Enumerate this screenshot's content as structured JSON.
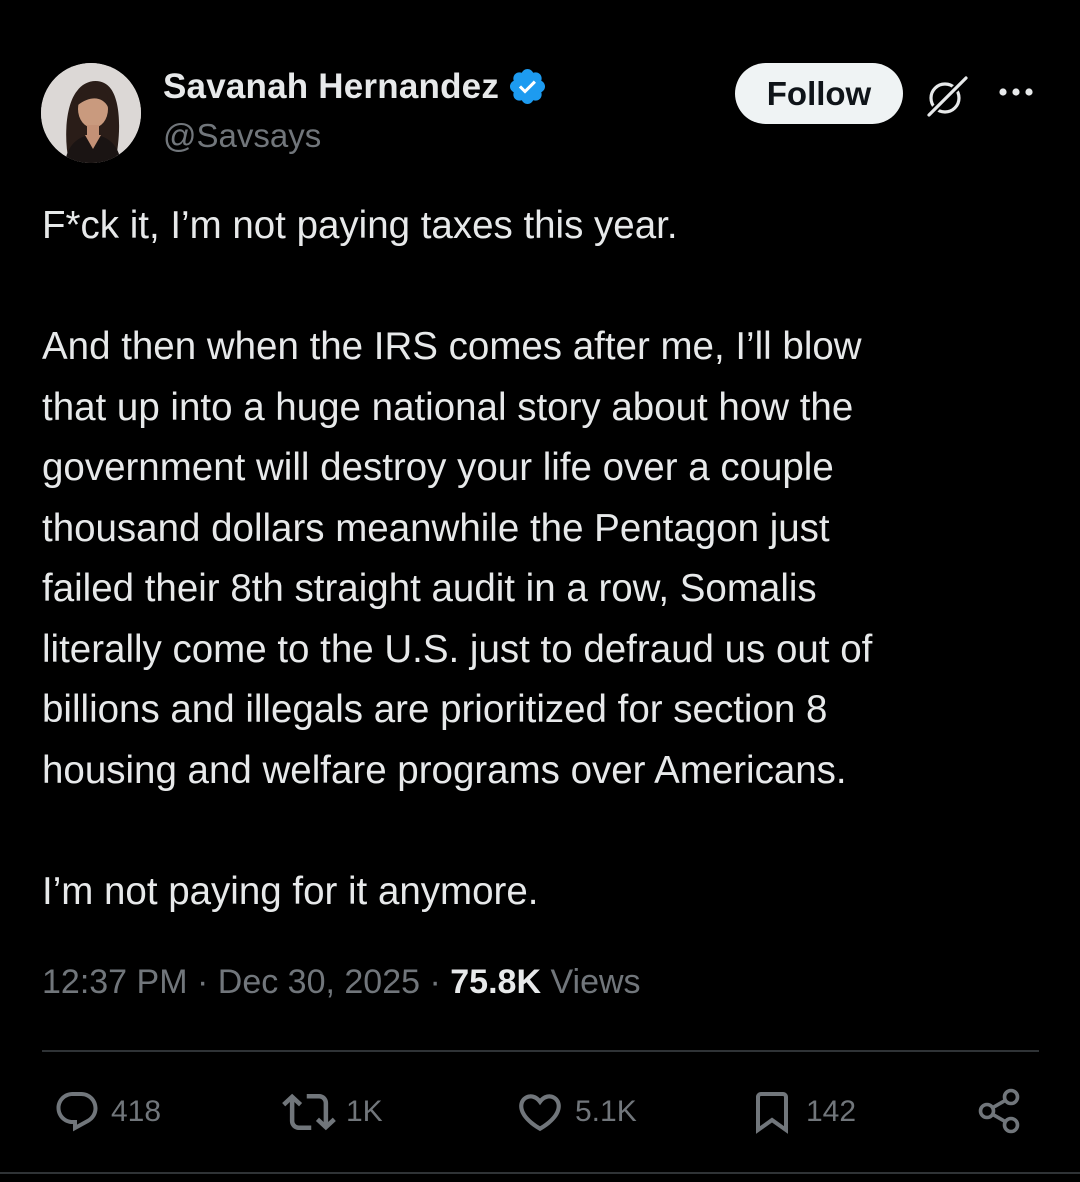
{
  "author": {
    "display_name": "Savanah Hernandez",
    "handle": "@Savsays",
    "verified": true,
    "verified_color": "#1d9bf0"
  },
  "header": {
    "follow_label": "Follow",
    "grok_icon": "grok-icon",
    "more_icon": "more-icon"
  },
  "tweet": {
    "lines": [
      "F*ck it, I’m not paying taxes this year.",
      "",
      "And then when the IRS comes after me, I’ll blow",
      "that up into a huge national story about how the",
      "government will destroy your life over a couple",
      "thousand dollars meanwhile the Pentagon just",
      "failed their 8th straight audit in a row, Somalis",
      "literally come to the U.S. just to defraud us out of",
      "billions and illegals are prioritized for section 8",
      "housing and welfare programs over Americans.",
      "",
      "I’m not paying for it anymore."
    ]
  },
  "meta": {
    "time": "12:37 PM",
    "separator": "·",
    "date": "Dec 30, 2025",
    "views_count": "75.8K",
    "views_label": "Views"
  },
  "actions": {
    "replies": "418",
    "reposts": "1K",
    "likes": "5.1K",
    "bookmarks": "142"
  },
  "colors": {
    "background": "#000000",
    "text_primary": "#e7e9ea",
    "text_secondary": "#71767b",
    "divider": "#2f3336",
    "follow_bg": "#eff3f4"
  }
}
